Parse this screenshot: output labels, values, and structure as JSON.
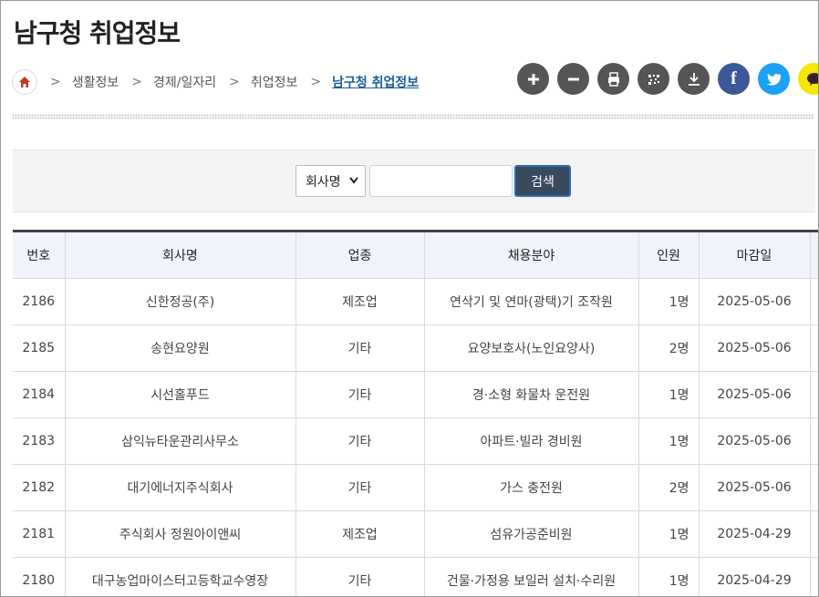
{
  "page": {
    "title": "남구청 취업정보"
  },
  "breadcrumb": {
    "home_icon": "home-icon",
    "items": [
      "생활정보",
      "경제/일자리",
      "취업정보",
      "남구청 취업정보"
    ]
  },
  "tools": {
    "icons": [
      "zoom-in-icon",
      "zoom-out-icon",
      "print-icon",
      "qr-code-icon",
      "download-icon",
      "facebook-icon",
      "twitter-icon",
      "kakaotalk-icon"
    ],
    "facebook_label": "f"
  },
  "search": {
    "select_value": "회사명",
    "input_value": "",
    "button_label": "검색"
  },
  "table": {
    "headers": [
      "번호",
      "회사명",
      "업종",
      "채용분야",
      "인원",
      "마감일"
    ],
    "rows": [
      [
        "2186",
        "신한정공(주)",
        "제조업",
        "연삭기 및 연마(광택)기 조작원",
        "1명",
        "2025-05-06"
      ],
      [
        "2185",
        "송현요양원",
        "기타",
        "요양보호사(노인요양사)",
        "2명",
        "2025-05-06"
      ],
      [
        "2184",
        "시선홀푸드",
        "기타",
        "경·소형 화물차 운전원",
        "1명",
        "2025-05-06"
      ],
      [
        "2183",
        "삼익뉴타운관리사무소",
        "기타",
        "아파트·빌라 경비원",
        "1명",
        "2025-05-06"
      ],
      [
        "2182",
        "대기에너지주식회사",
        "기타",
        "가스 충전원",
        "2명",
        "2025-05-06"
      ],
      [
        "2181",
        "주식회사 정원아이앤씨",
        "제조업",
        "섬유가공준비원",
        "1명",
        "2025-04-29"
      ],
      [
        "2180",
        "대구농업마이스터고등학교수영장",
        "기타",
        "건물·가정용 보일러 설치·수리원",
        "1명",
        "2025-04-29"
      ]
    ]
  },
  "colors": {
    "accent_link": "#1d5f9a",
    "tool_gray": "#555555",
    "facebook": "#3b5998",
    "twitter": "#1da1f2",
    "kakaotalk": "#f7e600",
    "search_button": "#384a5e",
    "home_icon": "#c0392b"
  }
}
